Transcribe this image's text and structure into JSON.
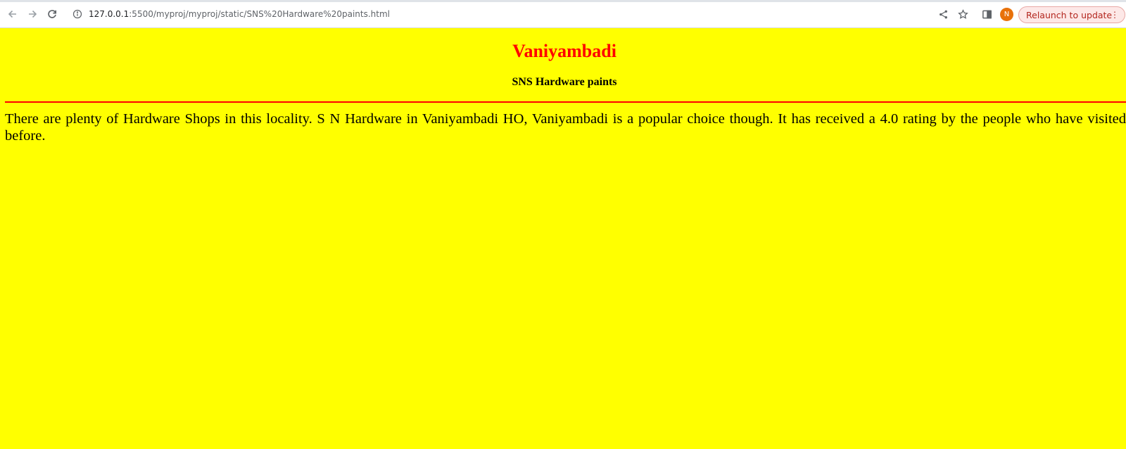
{
  "browser": {
    "url_host": "127.0.0.1",
    "url_path": ":5500/myproj/myproj/static/SNS%20Hardware%20paints.html",
    "profile_initial": "N",
    "relaunch_label": "Relaunch to update",
    "relaunch_menu_glyph": "⋮",
    "icons": {
      "back": "back-arrow-icon",
      "forward": "forward-arrow-icon",
      "reload": "reload-icon",
      "info": "info-icon",
      "share": "share-icon",
      "bookmark": "star-icon",
      "side_panel": "side-panel-icon"
    }
  },
  "page": {
    "background_color": "#ffff00",
    "title": "Vaniyambadi",
    "title_color": "#ff0000",
    "subtitle": "SNS Hardware paints",
    "divider_color": "#ff0000",
    "paragraph": "There are plenty of Hardware Shops in this locality. S N Hardware in Vaniyambadi HO, Vaniyambadi is a popular choice though. It has received a 4.0 rating by the people who have visited before."
  }
}
